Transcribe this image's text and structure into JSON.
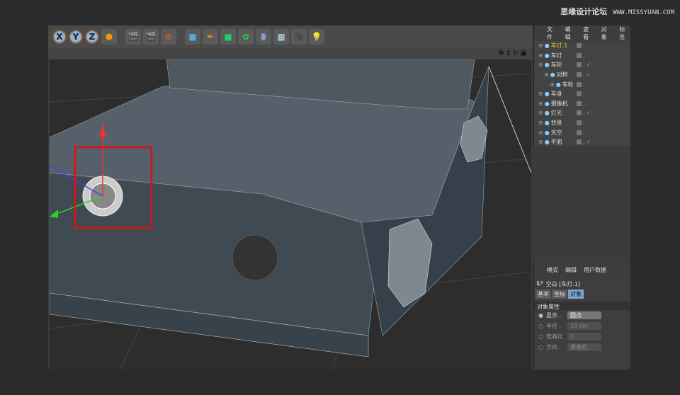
{
  "watermark": {
    "text": "思缘设计论坛",
    "url": "WWW.MISSYUAN.COM"
  },
  "toolbar": {
    "buttons": [
      "X",
      "Y",
      "Z"
    ],
    "icons": [
      "coordinate-system-icon",
      "render-view-icon",
      "render-picture-icon",
      "render-settings-icon",
      "cube-icon",
      "pen-icon",
      "subdivision-icon",
      "array-icon",
      "deformer-icon",
      "floor-icon",
      "camera-icon",
      "light-icon"
    ]
  },
  "object_manager": {
    "menu": [
      "文件",
      "编辑",
      "查看",
      "对象",
      "标签"
    ],
    "objects": [
      {
        "name": "车灯.1",
        "indent": 0,
        "selected": true,
        "check": false
      },
      {
        "name": "车灯",
        "indent": 0,
        "check": false
      },
      {
        "name": "车轮",
        "indent": 0,
        "check": true
      },
      {
        "name": "对称",
        "indent": 1,
        "check": true
      },
      {
        "name": "车轮",
        "indent": 2,
        "check": false
      },
      {
        "name": "车身",
        "indent": 0,
        "check": false
      },
      {
        "name": "摄像机",
        "indent": 0,
        "check": false
      },
      {
        "name": "灯光",
        "indent": 0,
        "check": true
      },
      {
        "name": "背景",
        "indent": 0,
        "check": false
      },
      {
        "name": "天空",
        "indent": 0,
        "check": false
      },
      {
        "name": "平面",
        "indent": 0,
        "check": true
      }
    ]
  },
  "attributes": {
    "menu": [
      "模式",
      "编辑",
      "用户数据"
    ],
    "title": "空白 [车灯.1]",
    "tabs": [
      "基本",
      "坐标",
      "对象"
    ],
    "active_tab": "对象",
    "section": "对象属性",
    "props": [
      {
        "label": "显示 .",
        "value": "圆点",
        "active": true
      },
      {
        "label": "半径 .",
        "value": "10 cm"
      },
      {
        "label": "宽高比",
        "value": "1"
      },
      {
        "label": "方向 .",
        "value": "摄像机"
      }
    ]
  },
  "colors": {
    "selection_box": "#e01010",
    "accent": "#7fa3cc"
  }
}
